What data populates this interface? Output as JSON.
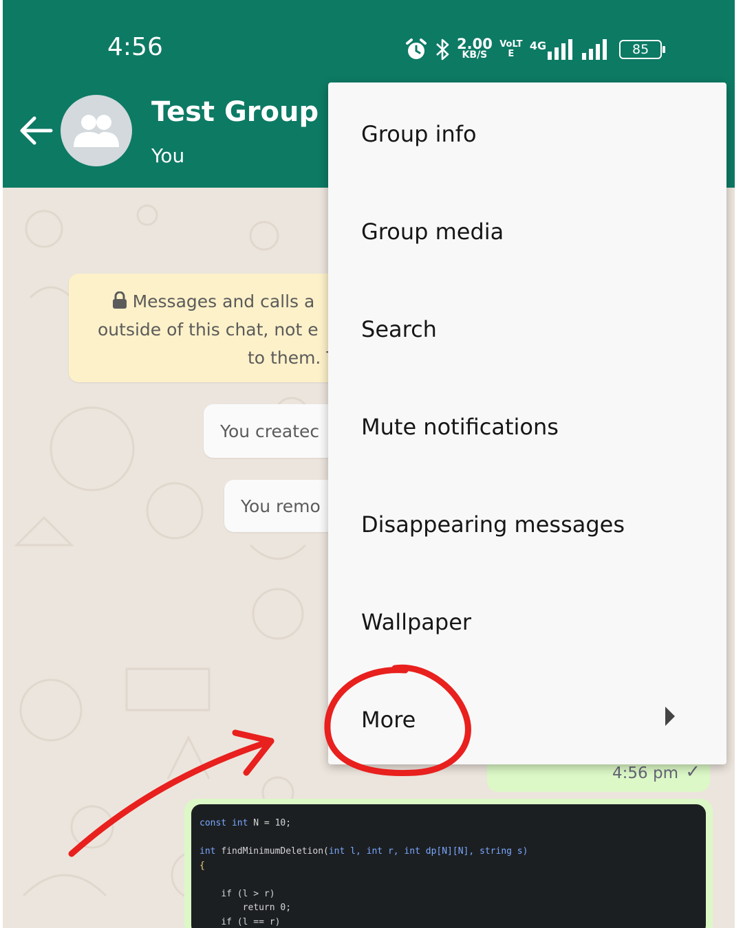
{
  "status_bar": {
    "time": "4:56",
    "net_speed": "2.00",
    "net_speed_unit": "KB/S",
    "volte": "VoLTE",
    "network": "4G",
    "battery": "85"
  },
  "header": {
    "title": "Test Group",
    "subtitle": "You"
  },
  "chat": {
    "encryption_line1": "Messages and calls a",
    "encryption_line2": "outside of this chat, not e",
    "encryption_line3": "to them. T",
    "system_msg_1": "You createc",
    "system_msg_2": "You remo",
    "last_msg_time": "4:56 pm",
    "tick": "✓"
  },
  "code_snippet": {
    "line1_kw1": "const",
    "line1_kw2": "int",
    "line1_rest": "N = 10;",
    "line2_kw": "int",
    "line2_fn": "findMinimumDeletion(",
    "line2_rest": "int l, int r, int dp[N][N], string s)",
    "line3": "{",
    "line4": "if (l > r)",
    "line5": "return 0;",
    "line6": "if (l == r)"
  },
  "menu": {
    "items": [
      {
        "label": "Group info"
      },
      {
        "label": "Group media"
      },
      {
        "label": "Search"
      },
      {
        "label": "Mute notifications"
      },
      {
        "label": "Disappearing messages"
      },
      {
        "label": "Wallpaper"
      },
      {
        "label": "More"
      }
    ]
  },
  "colors": {
    "header": "#0d7a64",
    "menu_bg": "#f8f8f8",
    "annotation": "#e8201e"
  }
}
